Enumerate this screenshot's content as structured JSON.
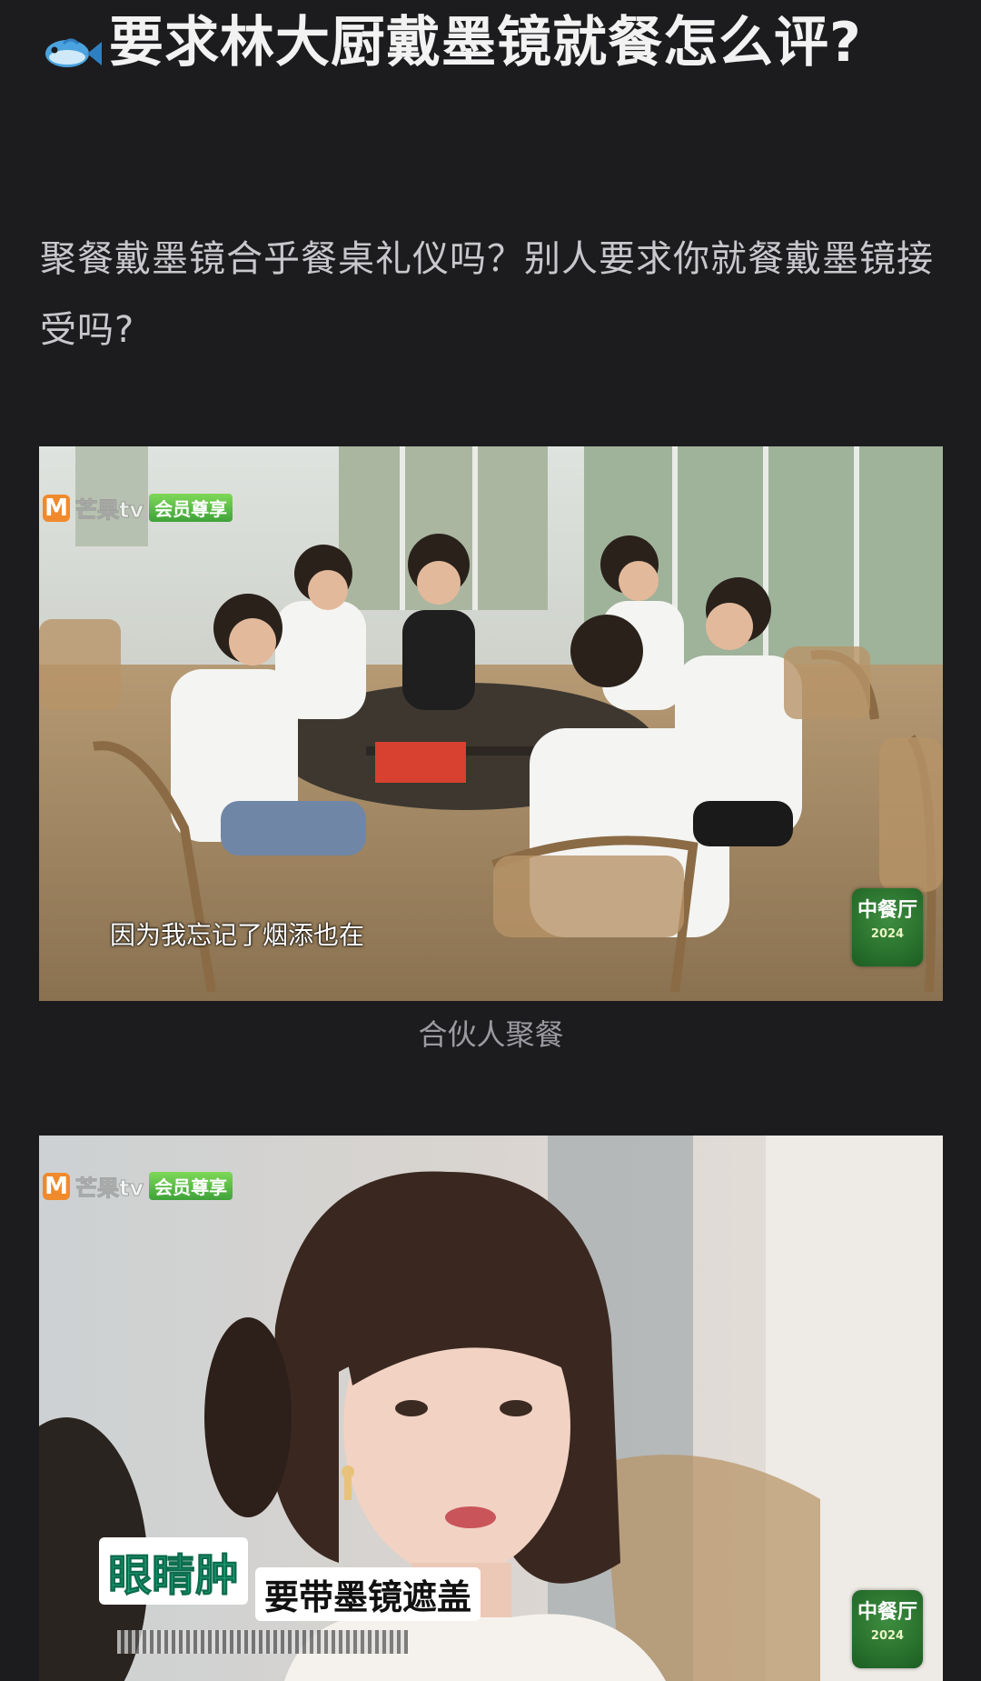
{
  "post": {
    "icon": "fish-icon",
    "title": "要求林大厨戴墨镜就餐怎么评?",
    "body": "聚餐戴墨镜合乎餐桌礼仪吗？别人要求你就餐戴墨镜接受吗?"
  },
  "images": [
    {
      "watermark_brand": "芒果tv",
      "watermark_badge": "会员尊享",
      "subtitle": "因为我忘记了烟添也在",
      "show_logo": "中餐厅",
      "show_logo_small": "2024",
      "caption": "合伙人聚餐"
    },
    {
      "watermark_brand": "芒果tv",
      "watermark_badge": "会员尊享",
      "overlay_title": "眼睛肿",
      "overlay_sub": "要带墨镜遮盖",
      "show_logo": "中餐厅",
      "show_logo_small": "2024"
    }
  ],
  "colors": {
    "background": "#1c1c1e",
    "title": "#f2f2f3",
    "body": "#c7c7cc",
    "caption": "#9a9aa0"
  }
}
